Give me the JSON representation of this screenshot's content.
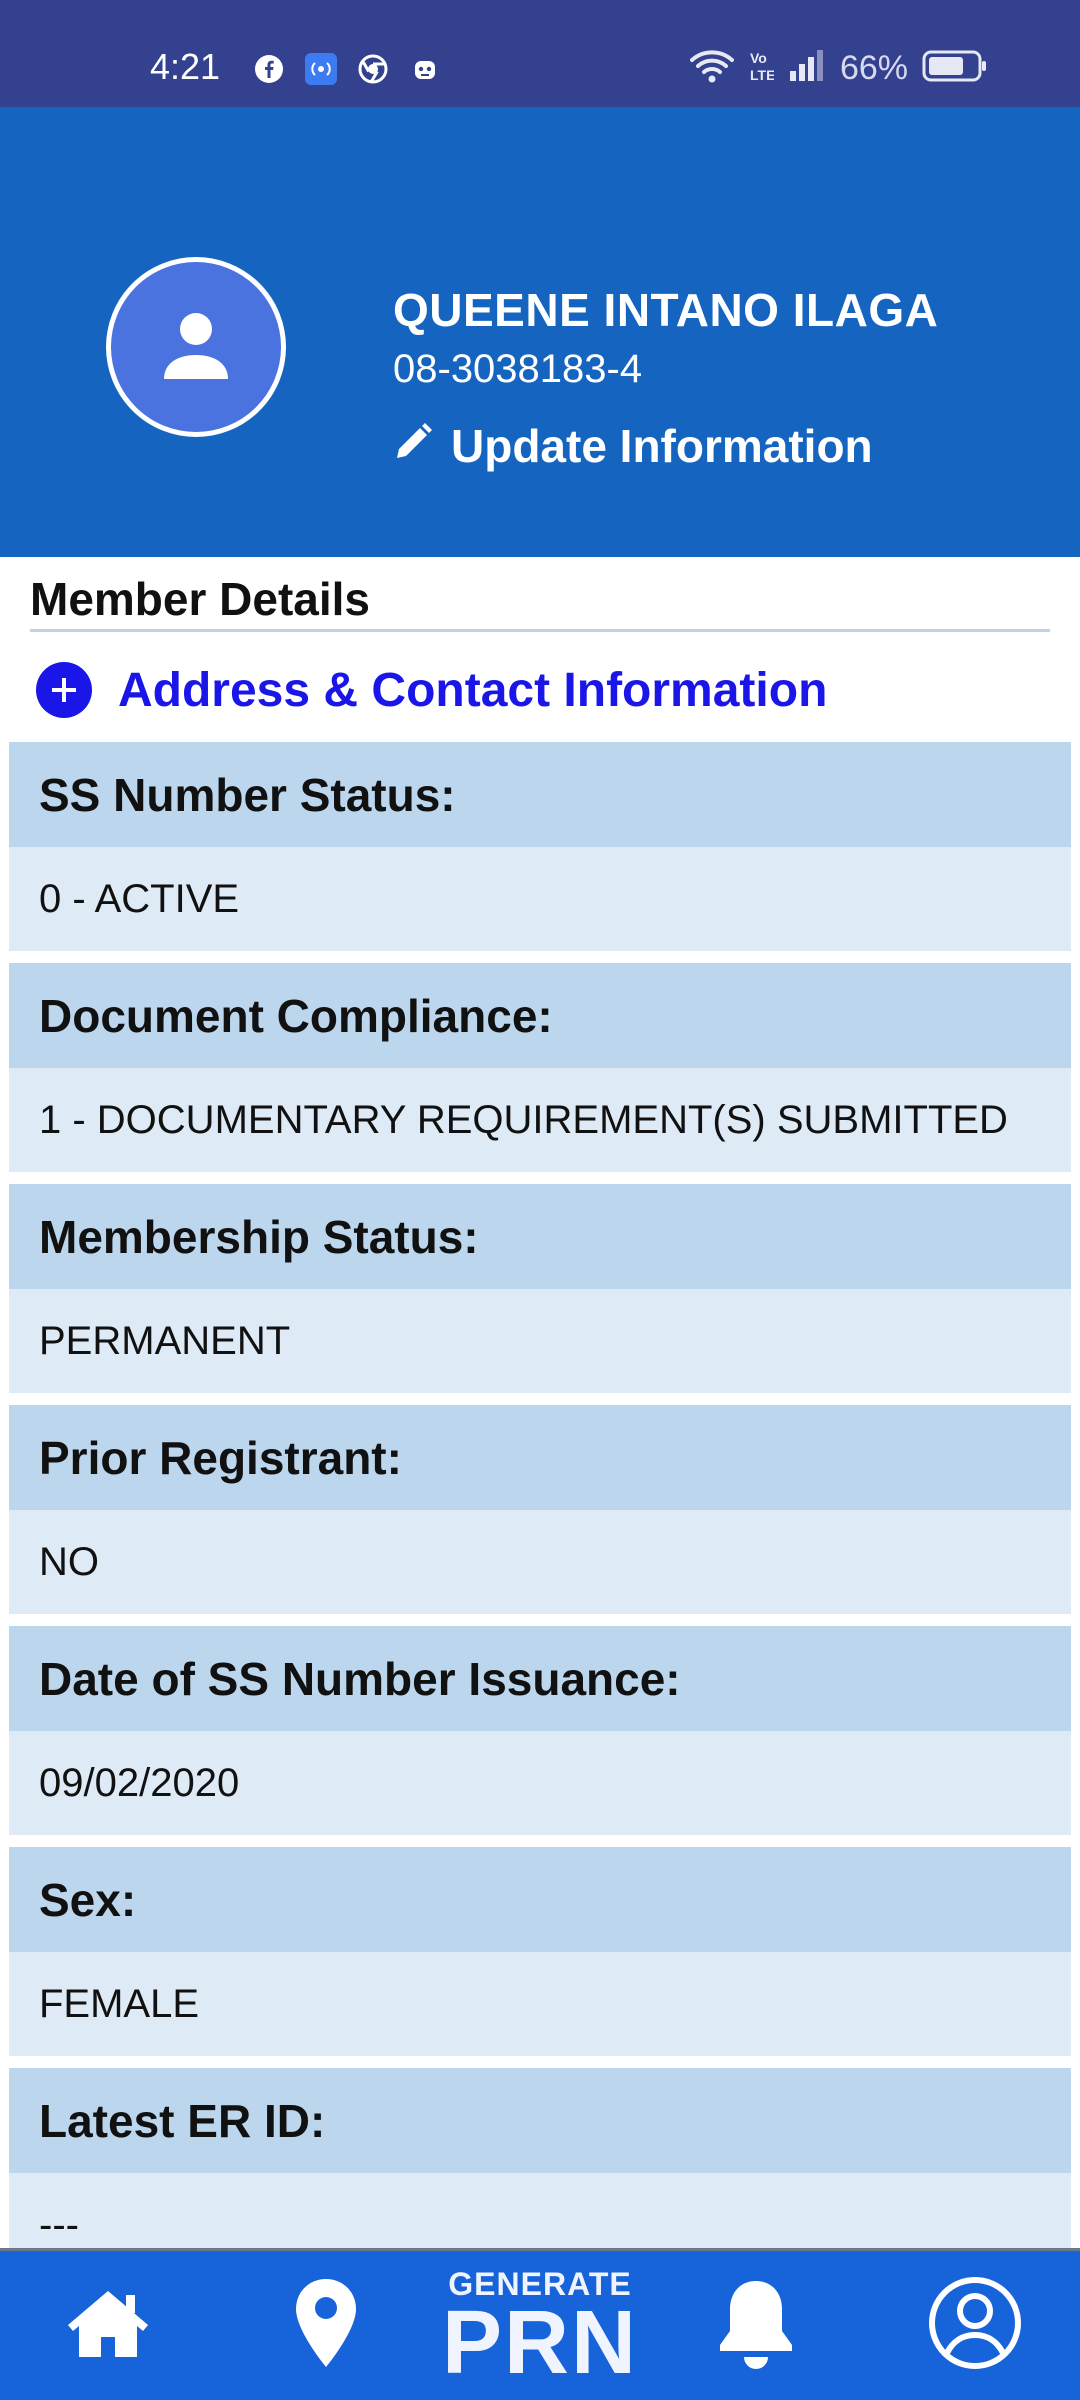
{
  "status_bar": {
    "time": "4:21",
    "app_icons": [
      "facebook-icon",
      "broadcast-icon",
      "chrome-icon",
      "robot-icon"
    ],
    "battery_percent": "66%"
  },
  "profile": {
    "name": "QUEENE INTANO ILAGA",
    "ss_number": "08-3038183-4",
    "update_label": "Update Information"
  },
  "member_details": {
    "title": "Member Details",
    "address_link": "Address & Contact Information",
    "fields": [
      {
        "label": "SS Number Status:",
        "value": "0 - ACTIVE"
      },
      {
        "label": "Document Compliance:",
        "value": "1 - DOCUMENTARY REQUIREMENT(S) SUBMITTED"
      },
      {
        "label": "Membership Status:",
        "value": "PERMANENT"
      },
      {
        "label": "Prior Registrant:",
        "value": "NO"
      },
      {
        "label": "Date of SS Number Issuance:",
        "value": "09/02/2020"
      },
      {
        "label": "Sex:",
        "value": "FEMALE"
      },
      {
        "label": "Latest ER ID:",
        "value": "---"
      }
    ]
  },
  "bottom_nav": {
    "generate_small": "GENERATE",
    "generate_big": "PRN",
    "accent_color": "#1763d9"
  },
  "colors": {
    "status_bar": "#33418f",
    "header": "#1565c0",
    "field_label_bg": "#bbd6ed",
    "field_value_bg": "#deeaf6",
    "link": "#1a16e8"
  }
}
